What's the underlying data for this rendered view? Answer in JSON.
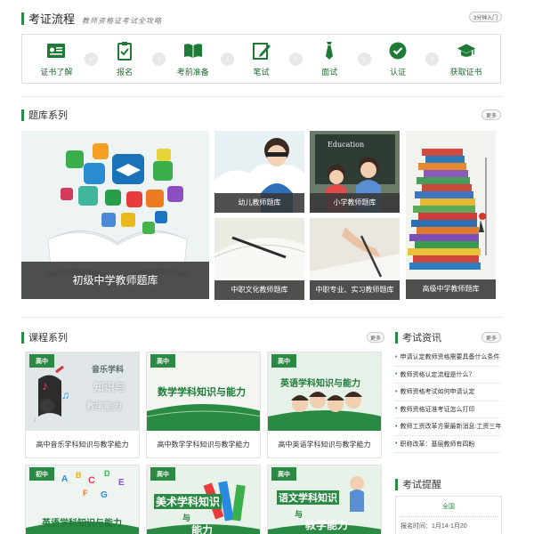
{
  "exam_flow": {
    "title": "考证流程",
    "subtitle": "教师资格证考试全攻略",
    "intro_button": "3分钟入门",
    "steps": [
      {
        "label": "证书了解",
        "icon": "certificate-icon"
      },
      {
        "label": "报名",
        "icon": "clipboard-icon"
      },
      {
        "label": "考前准备",
        "icon": "book-icon"
      },
      {
        "label": "笔试",
        "icon": "pencil-icon"
      },
      {
        "label": "面试",
        "icon": "tie-icon"
      },
      {
        "label": "认证",
        "icon": "check-circle-icon"
      },
      {
        "label": "获取证书",
        "icon": "graduation-cap-icon"
      }
    ]
  },
  "question_bank": {
    "title": "题库系列",
    "more": "更多",
    "tiles": [
      {
        "label": "初级中学教师题库"
      },
      {
        "label": "幼儿教师题库"
      },
      {
        "label": "小学教师题库",
        "board_text": "Education"
      },
      {
        "label": "中职文化教师题库"
      },
      {
        "label": "中职专业、实习教师题库"
      },
      {
        "label": "高级中学教师题库"
      }
    ]
  },
  "courses": {
    "title": "课程系列",
    "more": "更多",
    "items": [
      {
        "badge": "高中",
        "name": "高中音乐学科知识与教学能力",
        "banner": [
          "音乐学科",
          "知识与",
          "教学能力"
        ]
      },
      {
        "badge": "高中",
        "name": "高中数学学科知识与教学能力",
        "banner": [
          "数学学科知识与能力"
        ]
      },
      {
        "badge": "高中",
        "name": "高中英语学科知识与教学能力",
        "banner": [
          "英语学科知识与能力"
        ]
      },
      {
        "badge": "初中",
        "name": "",
        "banner": [
          "英语学科知识与能力"
        ]
      },
      {
        "badge": "高中",
        "name": "",
        "banner": [
          "美术学科知识",
          "与",
          "能力"
        ]
      },
      {
        "badge": "高中",
        "name": "",
        "banner": [
          "语文学科知识",
          "与",
          "教学能力"
        ]
      }
    ]
  },
  "news": {
    "title": "考试资讯",
    "more": "更多",
    "items": [
      "申请认定教师资格需要具备什么条件",
      "教师资格认定流程是什么？",
      "教师资格考试如何申请认定",
      "教师资格证准考证怎么打印",
      "教师工资改革方案最新消息:工资三年一...",
      "职称改革：基层教师有四盼"
    ]
  },
  "reminder": {
    "title": "考试提醒",
    "region": "全国",
    "date_label": "报名时间：1月14-1月20"
  },
  "colors": {
    "accent": "#2a8a43",
    "accent_light": "#e9f3e6"
  }
}
